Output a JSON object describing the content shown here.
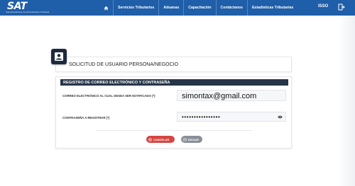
{
  "header": {
    "logo_text": "SAT",
    "logo_tagline": "Superintendencia de Administración Tributaria",
    "nav_items": [
      "Servicios Tributarios",
      "Aduanas",
      "Capacitación",
      "Contáctanos",
      "Estadísticas Tributarias"
    ],
    "right_label": "ISSO",
    "color": "#1f5ea8"
  },
  "page": {
    "title": "SOLICITUD DE USUARIO PERSONA/NEGOCIO",
    "section_title": "REGISTRO DE CORREO ELECTRÓNICO Y CONTRASEÑA",
    "email_label": "CORREO ELECTRÓNICO AL CUAL DESEA SER NOTIFICADO (*)",
    "email_value": "simontax@gmail.com",
    "password_label": "CONTRASEÑA A REGISTRAR (*)",
    "password_value": "••••••••••••••••",
    "cancel_label": "CANCELAR",
    "send_label": "ENVIAR"
  },
  "icons": [
    "home-icon",
    "exit-icon",
    "user-card-icon",
    "eye-icon",
    "cancel-icon",
    "send-icon"
  ],
  "colors": {
    "section_bar": "#263548",
    "cancel": "#d64541",
    "send": "#8a8f98"
  }
}
